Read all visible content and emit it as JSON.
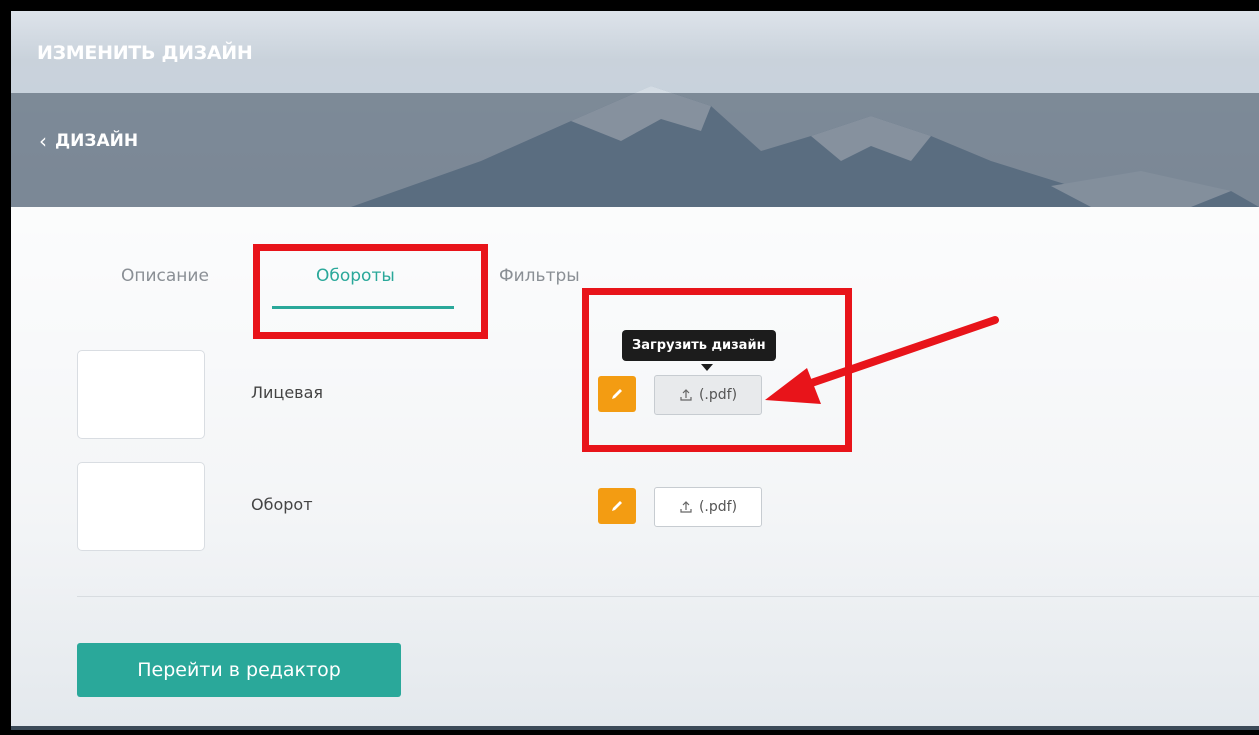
{
  "header": {
    "title": "ИЗМЕНИТЬ ДИЗАЙН",
    "back_label": "ДИЗАЙН"
  },
  "tabs": [
    {
      "label": "Описание",
      "active": false
    },
    {
      "label": "Обороты",
      "active": true
    },
    {
      "label": "Фильтры",
      "active": false
    }
  ],
  "sides": [
    {
      "label": "Лицевая",
      "upload_label": "(.pdf)",
      "hovered": true
    },
    {
      "label": "Оборот",
      "upload_label": "(.pdf)",
      "hovered": false
    }
  ],
  "tooltip": "Загрузить дизайн",
  "editor_button": "Перейти в редактор",
  "colors": {
    "accent": "#2aa89a",
    "edit": "#f39c12",
    "annotation": "#e8141a"
  },
  "icons": {
    "back": "chevron-left-icon",
    "edit": "pencil-icon",
    "upload": "upload-icon"
  }
}
